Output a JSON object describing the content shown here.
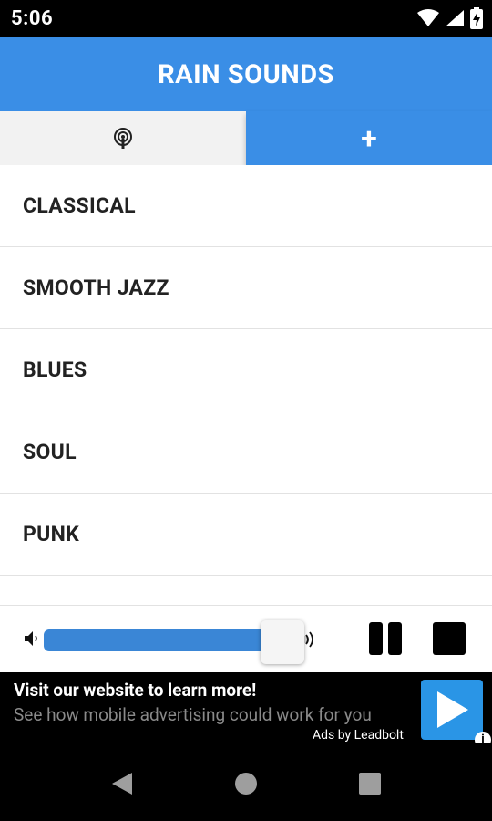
{
  "status_bar": {
    "time": "5:06",
    "icons": [
      "wifi-icon",
      "cell-signal-icon",
      "battery-charging-icon"
    ]
  },
  "app": {
    "title": "RAIN SOUNDS",
    "accent_color": "#3a8ee6"
  },
  "tabs": [
    {
      "icon": "podcast-icon",
      "label": "",
      "active": false
    },
    {
      "icon": "plus-icon",
      "label": "+",
      "active": true
    }
  ],
  "stations": [
    {
      "label": "CLASSICAL"
    },
    {
      "label": "SMOOTH JAZZ"
    },
    {
      "label": "BLUES"
    },
    {
      "label": "SOUL"
    },
    {
      "label": "PUNK"
    },
    {
      "label": ""
    }
  ],
  "player": {
    "volume_fraction": 0.84,
    "icons": [
      "volume-low-icon",
      "volume-high-icon",
      "pause-icon",
      "stop-icon"
    ]
  },
  "ad": {
    "headline": "Visit our website to learn more!",
    "subtext": "See how mobile advertising could work for you",
    "attribution": "Ads by Leadbolt",
    "info": "i",
    "cta_icon": "play-icon",
    "cta_color": "#2a95e6"
  },
  "nav_bar": {
    "icons": [
      "back-icon",
      "home-icon",
      "recents-icon"
    ]
  }
}
